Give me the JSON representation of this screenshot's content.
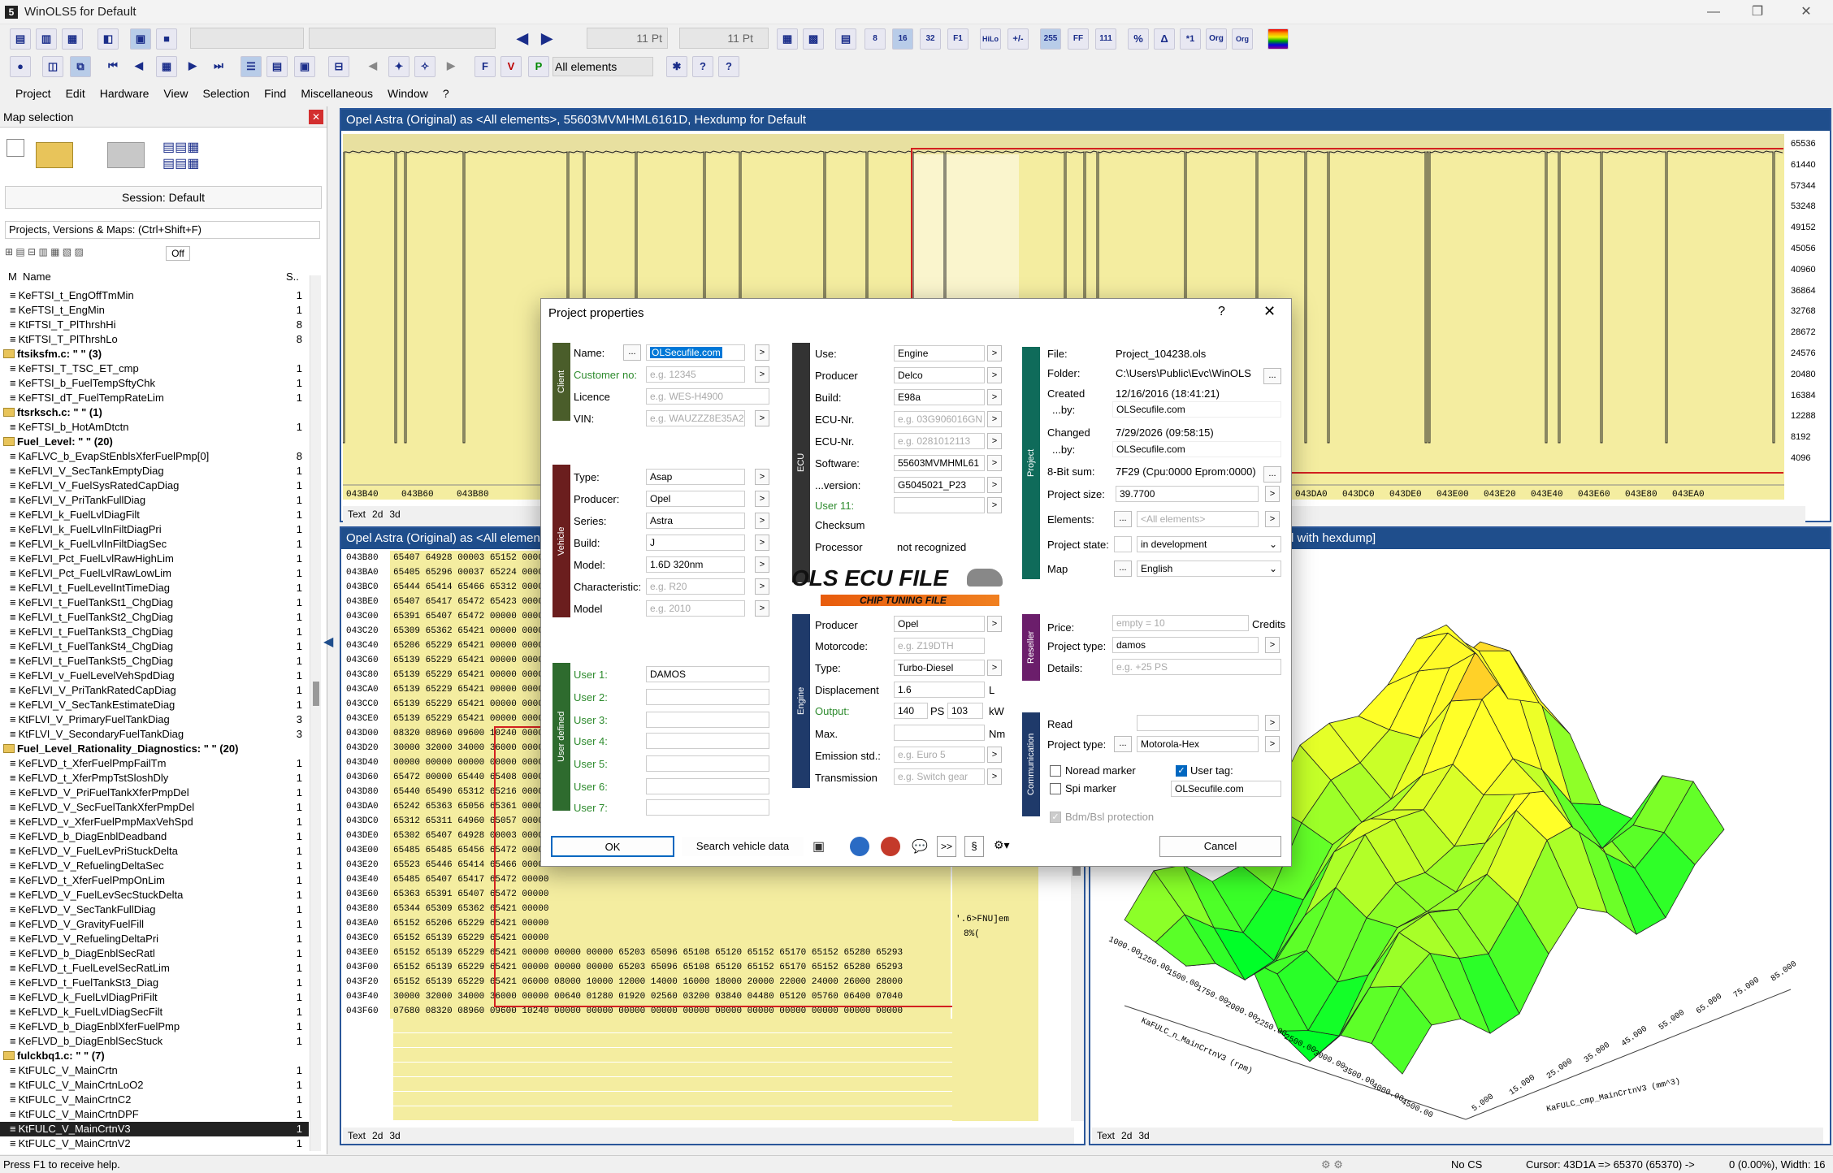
{
  "window": {
    "title": "WinOLS5 for Default",
    "app_icon": "5"
  },
  "toolbar": {
    "font_size_1": "11 Pt",
    "font_size_2": "11 Pt",
    "elements_label": "All elements"
  },
  "menu": [
    "Project",
    "Edit",
    "Hardware",
    "View",
    "Selection",
    "Find",
    "Miscellaneous",
    "Window",
    "?"
  ],
  "left_panel": {
    "title": "Map selection",
    "session": "Session: Default",
    "filter": "Projects, Versions & Maps:  (Ctrl+Shift+F)",
    "off": "Off",
    "col_m": "M",
    "col_name": "Name",
    "col_s": "S..",
    "rows": [
      {
        "name": "KeFTSI_t_EngOffTmMin",
        "s": "1",
        "type": "item"
      },
      {
        "name": "KeFTSI_t_EngMin",
        "s": "1",
        "type": "item"
      },
      {
        "name": "KtFTSI_T_PlThrshHi",
        "s": "8",
        "type": "item"
      },
      {
        "name": "KtFTSI_T_PlThrshLo",
        "s": "8",
        "type": "item"
      },
      {
        "name": "ftsiksfm.c: \" \" (3)",
        "s": "",
        "type": "grp"
      },
      {
        "name": "KeFTSI_T_TSC_ET_cmp",
        "s": "1",
        "type": "item"
      },
      {
        "name": "KeFTSI_b_FuelTempSftyChk",
        "s": "1",
        "type": "item"
      },
      {
        "name": "KeFTSI_dT_FuelTempRateLim",
        "s": "1",
        "type": "item"
      },
      {
        "name": "ftsrksch.c: \" \" (1)",
        "s": "",
        "type": "grp"
      },
      {
        "name": "KeFTSI_b_HotAmDtctn",
        "s": "1",
        "type": "item"
      },
      {
        "name": "Fuel_Level: \" \" (20)",
        "s": "",
        "type": "grp"
      },
      {
        "name": "KaFLVC_b_EvapStEnblsXferFuelPmp[0]",
        "s": "8",
        "type": "item"
      },
      {
        "name": "KeFLVI_V_SecTankEmptyDiag",
        "s": "1",
        "type": "item"
      },
      {
        "name": "KeFLVI_V_FuelSysRatedCapDiag",
        "s": "1",
        "type": "item"
      },
      {
        "name": "KeFLVI_V_PriTankFullDiag",
        "s": "1",
        "type": "item"
      },
      {
        "name": "KeFLVI_k_FuelLvlDiagFilt",
        "s": "1",
        "type": "item"
      },
      {
        "name": "KeFLVI_k_FuelLvlInFiltDiagPri",
        "s": "1",
        "type": "item"
      },
      {
        "name": "KeFLVI_k_FuelLvlInFiltDiagSec",
        "s": "1",
        "type": "item"
      },
      {
        "name": "KeFLVI_Pct_FuelLvlRawHighLim",
        "s": "1",
        "type": "item"
      },
      {
        "name": "KeFLVI_Pct_FuelLvlRawLowLim",
        "s": "1",
        "type": "item"
      },
      {
        "name": "KeFLVI_t_FuelLevelIntTimeDiag",
        "s": "1",
        "type": "item"
      },
      {
        "name": "KeFLVI_t_FuelTankSt1_ChgDiag",
        "s": "1",
        "type": "item"
      },
      {
        "name": "KeFLVI_t_FuelTankSt2_ChgDiag",
        "s": "1",
        "type": "item"
      },
      {
        "name": "KeFLVI_t_FuelTankSt3_ChgDiag",
        "s": "1",
        "type": "item"
      },
      {
        "name": "KeFLVI_t_FuelTankSt4_ChgDiag",
        "s": "1",
        "type": "item"
      },
      {
        "name": "KeFLVI_t_FuelTankSt5_ChgDiag",
        "s": "1",
        "type": "item"
      },
      {
        "name": "KeFLVI_v_FuelLevelVehSpdDiag",
        "s": "1",
        "type": "item"
      },
      {
        "name": "KeFLVI_V_PriTankRatedCapDiag",
        "s": "1",
        "type": "item"
      },
      {
        "name": "KeFLVI_V_SecTankEstimateDiag",
        "s": "1",
        "type": "item"
      },
      {
        "name": "KtFLVI_V_PrimaryFuelTankDiag",
        "s": "3",
        "type": "item"
      },
      {
        "name": "KtFLVI_V_SecondaryFuelTankDiag",
        "s": "3",
        "type": "item"
      },
      {
        "name": "Fuel_Level_Rationality_Diagnostics: \" \" (20)",
        "s": "",
        "type": "grp"
      },
      {
        "name": "KeFLVD_t_XferFuelPmpFailTm",
        "s": "1",
        "type": "item"
      },
      {
        "name": "KeFLVD_t_XferPmpTstSloshDly",
        "s": "1",
        "type": "item"
      },
      {
        "name": "KeFLVD_V_PriFuelTankXferPmpDel",
        "s": "1",
        "type": "item"
      },
      {
        "name": "KeFLVD_V_SecFuelTankXferPmpDel",
        "s": "1",
        "type": "item"
      },
      {
        "name": "KeFLVD_v_XferFuelPmpMaxVehSpd",
        "s": "1",
        "type": "item"
      },
      {
        "name": "KeFLVD_b_DiagEnblDeadband",
        "s": "1",
        "type": "item"
      },
      {
        "name": "KeFLVD_V_FuelLevPriStuckDelta",
        "s": "1",
        "type": "item"
      },
      {
        "name": "KeFLVD_V_RefuelingDeltaSec",
        "s": "1",
        "type": "item"
      },
      {
        "name": "KeFLVD_t_XferFuelPmpOnLim",
        "s": "1",
        "type": "item"
      },
      {
        "name": "KeFLVD_V_FuelLevSecStuckDelta",
        "s": "1",
        "type": "item"
      },
      {
        "name": "KeFLVD_V_SecTankFullDiag",
        "s": "1",
        "type": "item"
      },
      {
        "name": "KeFLVD_V_GravityFuelFill",
        "s": "1",
        "type": "item"
      },
      {
        "name": "KeFLVD_V_RefuelingDeltaPri",
        "s": "1",
        "type": "item"
      },
      {
        "name": "KeFLVD_b_DiagEnblSecRatl",
        "s": "1",
        "type": "item"
      },
      {
        "name": "KeFLVD_t_FuelLevelSecRatLim",
        "s": "1",
        "type": "item"
      },
      {
        "name": "KeFLVD_t_FuelTankSt3_Diag",
        "s": "1",
        "type": "item"
      },
      {
        "name": "KeFLVD_k_FuelLvlDiagPriFilt",
        "s": "1",
        "type": "item"
      },
      {
        "name": "KeFLVD_k_FuelLvlDiagSecFilt",
        "s": "1",
        "type": "item"
      },
      {
        "name": "KeFLVD_b_DiagEnblXferFuelPmp",
        "s": "1",
        "type": "item"
      },
      {
        "name": "KeFLVD_b_DiagEnblSecStuck",
        "s": "1",
        "type": "item"
      },
      {
        "name": "fulckbq1.c: \" \" (7)",
        "s": "",
        "type": "grp"
      },
      {
        "name": "KtFULC_V_MainCrtn",
        "s": "1",
        "type": "item"
      },
      {
        "name": "KtFULC_V_MainCrtnLoO2",
        "s": "1",
        "type": "item"
      },
      {
        "name": "KtFULC_V_MainCrtnC2",
        "s": "1",
        "type": "item"
      },
      {
        "name": "KtFULC_V_MainCrtnDPF",
        "s": "1",
        "type": "item"
      },
      {
        "name": "KtFULC_V_MainCrtnV3",
        "s": "1",
        "type": "sel"
      },
      {
        "name": "KtFULC_V_MainCrtnV2",
        "s": "1",
        "type": "item"
      }
    ]
  },
  "graph_window": {
    "title": "Opel Astra (Original) as <All elements>, 55603MVMHML6161D, Hexdump for Default",
    "y_ticks": [
      "65536",
      "61440",
      "57344",
      "53248",
      "49152",
      "45056",
      "40960",
      "36864",
      "32768",
      "28672",
      "24576",
      "20480",
      "16384",
      "12288",
      "8192",
      "4096"
    ],
    "x_ticks_left": [
      "043B40",
      "043B60",
      "043B80"
    ],
    "x_ticks_right": [
      "043D80",
      "043DA0",
      "043DC0",
      "043DE0",
      "043E00",
      "043E20",
      "043E40",
      "043E60",
      "043E80",
      "043EA0"
    ],
    "tabs": [
      "Text",
      "2d",
      "3d"
    ]
  },
  "hex_window": {
    "title": "Opel Astra (Original) as <All elements>",
    "right_title": "d with hexdump]",
    "ascii_a": "'.6>FNU]em",
    "ascii_b": "8%(",
    "tabs": [
      "Text",
      "2d",
      "3d"
    ],
    "rows": [
      {
        "a": "043B80",
        "v": "65407 64928 00003 65152 00000"
      },
      {
        "a": "043BA0",
        "v": "65405 65296 00037 65224 00000"
      },
      {
        "a": "043BC0",
        "v": "65444 65414 65466 65312 00000"
      },
      {
        "a": "043BE0",
        "v": "65407 65417 65472 65423 00000"
      },
      {
        "a": "043C00",
        "v": "65391 65407 65472 00000 00000"
      },
      {
        "a": "043C20",
        "v": "65309 65362 65421 00000 00000"
      },
      {
        "a": "043C40",
        "v": "65206 65229 65421 00000 00000"
      },
      {
        "a": "043C60",
        "v": "65139 65229 65421 00000 00000"
      },
      {
        "a": "043C80",
        "v": "65139 65229 65421 00000 00000"
      },
      {
        "a": "043CA0",
        "v": "65139 65229 65421 00000 00000"
      },
      {
        "a": "043CC0",
        "v": "65139 65229 65421 00000 00000"
      },
      {
        "a": "043CE0",
        "v": "65139 65229 65421 00000 00000"
      },
      {
        "a": "043D00",
        "v": "08320 08960 09600 10240 00000"
      },
      {
        "a": "043D20",
        "v": "30000 32000 34000 36000 00000"
      },
      {
        "a": "043D40",
        "v": "00000 00000 00000 00000 00000"
      },
      {
        "a": "043D60",
        "v": "65472 00000 65440 65408 00000"
      },
      {
        "a": "043D80",
        "v": "65440 65490 65312 65216 00000"
      },
      {
        "a": "043DA0",
        "v": "65242 65363 65056 65361 00000"
      },
      {
        "a": "043DC0",
        "v": "65312 65311 64960 65057 00000"
      },
      {
        "a": "043DE0",
        "v": "65302 65407 64928 00003 00000"
      },
      {
        "a": "043E00",
        "v": "65485 65485 65456 65472 00000"
      },
      {
        "a": "043E20",
        "v": "65523 65446 65414 65466 00000"
      },
      {
        "a": "043E40",
        "v": "65485 65407 65417 65472 00000"
      },
      {
        "a": "043E60",
        "v": "65363 65391 65407 65472 00000"
      },
      {
        "a": "043E80",
        "v": "65344 65309 65362 65421 00000"
      },
      {
        "a": "043EA0",
        "v": "65152 65206 65229 65421 00000"
      },
      {
        "a": "043EC0",
        "v": "65152 65139 65229 65421 00000"
      },
      {
        "a": "043EE0",
        "v": "65152 65139 65229 65421 00000 00000 00000 65203 65096 65108 65120 65152 65170 65152 65280 65293"
      },
      {
        "a": "043F00",
        "v": "65152 65139 65229 65421 00000 00000 00000 65203 65096 65108 65120 65152 65170 65152 65280 65293"
      },
      {
        "a": "043F20",
        "v": "65152 65139 65229 65421 06000 08000 10000 12000 14000 16000 18000 20000 22000 24000 26000 28000"
      },
      {
        "a": "043F40",
        "v": "30000 32000 34000 36000 00000 00640 01280 01920 02560 03200 03840 04480 05120 05760 06400 07040"
      },
      {
        "a": "043F60",
        "v": "07680 08320 08960 09600 10240 00000 00000 00000 00000 00000 00000 00000 00000 00000 00000 00000"
      }
    ]
  },
  "surface_window": {
    "axis_x_label": "KaFULC_n_MainCrtnV3 (rpm)",
    "axis_y_label": "KaFULC_cmp_MainCrtnV3 (mm^3)",
    "x_ticks": [
      "1000.00",
      "1250.00",
      "1500.00",
      "1750.00",
      "2000.00",
      "2250.00",
      "2500.00",
      "3000.00",
      "3500.00",
      "4000.00",
      "4500.00"
    ],
    "y_ticks": [
      "5.000",
      "15.000",
      "25.000",
      "35.000",
      "45.000",
      "55.000",
      "65.000",
      "75.000",
      "85.000"
    ],
    "tabs": [
      "Text",
      "2d",
      "3d"
    ]
  },
  "dialog": {
    "title": "Project properties",
    "help": "?",
    "close": "✕",
    "client": {
      "section": "Client",
      "name_label": "Name:",
      "name_value": "OLSecufile.com",
      "customer_label": "Customer no:",
      "customer_ph": "e.g. 12345",
      "licence_label": "Licence",
      "licence_ph": "e.g. WES-H4900",
      "vin_label": "VIN:",
      "vin_ph": "e.g. WAUZZZ8E35A23"
    },
    "vehicle": {
      "section": "Vehicle",
      "type_label": "Type:",
      "type_value": "Asap",
      "producer_label": "Producer:",
      "producer_value": "Opel",
      "series_label": "Series:",
      "series_value": "Astra",
      "build_label": "Build:",
      "build_value": "J",
      "model_label": "Model:",
      "model_value": "1.6D 320nm",
      "char_label": "Characteristic:",
      "char_ph": "e.g. R20",
      "model2_label": "Model",
      "model2_ph": "e.g. 2010"
    },
    "userdef": {
      "section": "User defined",
      "u1": "User 1:",
      "u1_value": "DAMOS",
      "u2": "User 2:",
      "u3": "User 3:",
      "u4": "User 4:",
      "u5": "User 5:",
      "u6": "User 6:",
      "u7": "User 7:"
    },
    "ecu": {
      "section": "ECU",
      "use_label": "Use:",
      "use_value": "Engine",
      "producer_label": "Producer",
      "producer_value": "Delco",
      "build_label": "Build:",
      "build_value": "E98a",
      "ecunr1_label": "ECU-Nr.",
      "ecunr1_ph": "e.g. 03G906016GN",
      "ecunr2_label": "ECU-Nr.",
      "ecunr2_ph": "e.g. 0281012113",
      "software_label": "Software:",
      "software_value": "55603MVMHML61",
      "version_label": "...version:",
      "version_value": "G5045021_P23",
      "user11_label": "User 11:",
      "checksum_label": "Checksum",
      "processor_label": "Processor",
      "processor_value": "not recognized"
    },
    "logo": {
      "line1": "OLS ECU FILE",
      "line2": "CHIP TUNING FILE"
    },
    "engine": {
      "section": "Engine",
      "producer_label": "Producer",
      "producer_value": "Opel",
      "motorcode_label": "Motorcode:",
      "motorcode_ph": "e.g. Z19DTH",
      "type_label": "Type:",
      "type_value": "Turbo-Diesel",
      "disp_label": "Displacement",
      "disp_value": "1.6",
      "disp_unit": "L",
      "output_label": "Output:",
      "output_ps": "140",
      "ps": "PS",
      "output_kw": "103",
      "kw": "kW",
      "max_label": "Max.",
      "nm": "Nm",
      "emission_label": "Emission std.:",
      "emission_ph": "e.g. Euro 5",
      "trans_label": "Transmission",
      "trans_ph": "e.g. Switch gear"
    },
    "project": {
      "section": "Project",
      "file_label": "File:",
      "file_value": "Project_104238.ols",
      "folder_label": "Folder:",
      "folder_value": "C:\\Users\\Public\\Evc\\WinOLS",
      "created_label": "Created",
      "created_value": "12/16/2016 (18:41:21)",
      "createdby_label": "...by:",
      "createdby_value": "OLSecufile.com",
      "changed_label": "Changed",
      "changed_value": "7/29/2026 (09:58:15)",
      "changedby_label": "...by:",
      "changedby_value": "OLSecufile.com",
      "checksum_label": "8-Bit sum:",
      "checksum_value": "7F29 (Cpu:0000 Eprom:0000)",
      "size_label": "Project size:",
      "size_value": "39.7700",
      "elements_label": "Elements:",
      "elements_value": "<All elements>",
      "state_label": "Project state:",
      "state_value": "in development",
      "map_label": "Map",
      "map_value": "English"
    },
    "reseller": {
      "section": "Reseller",
      "price_label": "Price:",
      "price_ph": "empty = 10",
      "credits": "Credits",
      "ptype_label": "Project type:",
      "ptype_value": "damos",
      "details_label": "Details:",
      "details_ph": "e.g. +25 PS"
    },
    "comm": {
      "section": "Communication",
      "read_label": "Read",
      "ptype_label": "Project type:",
      "ptype_value": "Motorola-Hex",
      "noread": "Noread marker",
      "spi": "Spi marker",
      "usertag": "User tag:",
      "usertag_value": "OLSecufile.com",
      "bdm": "Bdm/Bsl protection"
    },
    "buttons": {
      "ok": "OK",
      "search": "Search vehicle data",
      "cancel": "Cancel",
      "section": "§",
      "more": ">>"
    }
  },
  "status": {
    "help": "Press F1 to receive help.",
    "cs": "No CS",
    "cursor": "Cursor: 43D1A => 65370 (65370) ->",
    "zoom": "0 (0.00%), Width: 16"
  }
}
